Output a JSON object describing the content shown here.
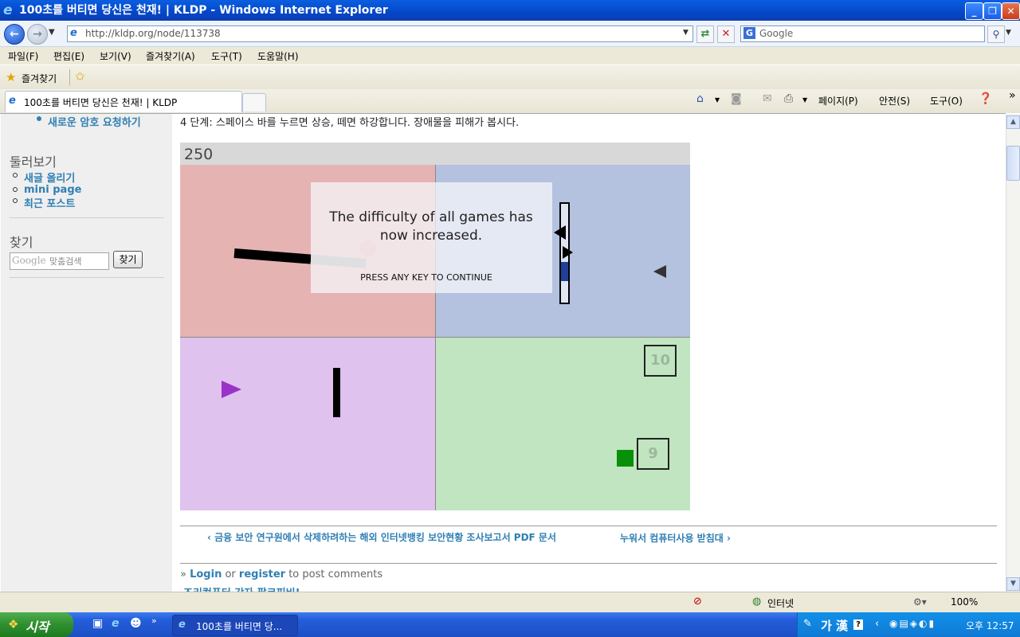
{
  "window": {
    "title": "100초를 버티면 당신은 천재! | KLDP - Windows Internet Explorer",
    "minimize": "_",
    "restore": "❐",
    "close": "✕"
  },
  "address_bar": {
    "url": "http://kldp.org/node/113738",
    "search_placeholder": "Google",
    "search_logo": "G"
  },
  "menu": [
    "파일(F)",
    "편집(E)",
    "보기(V)",
    "즐겨찾기(A)",
    "도구(T)",
    "도움말(H)"
  ],
  "favorites": {
    "label": "즐겨찾기"
  },
  "tab": {
    "title": "100초를 버티면 당신은 천재! | KLDP"
  },
  "command_bar": {
    "page": "페이지(P)",
    "safety": "안전(S)",
    "tools": "도구(O)"
  },
  "sidebar": {
    "top_link": "새로운 암호 요청하기",
    "browse_title": "둘러보기",
    "browse_links": [
      "새글 올리기",
      "mini page",
      "최근 포스트"
    ],
    "search_title": "찾기",
    "search_brand": "Google",
    "search_hint": "맞춤검색",
    "search_button": "찾기"
  },
  "article": {
    "top_text": "4 단계: 스페이스 바를 누르면 상승, 떼면 하강합니다. 장애물을 피해가 봅시다.",
    "prev_link": "‹ 금융 보안 연구원에서 삭제하려하는 해외 인터넷뱅킹 보안현황 조사보고서 PDF 문서",
    "next_link": "누워서 컴퓨터사용 받침대 ›",
    "login_prefix": "» ",
    "login": "Login",
    "or": " or ",
    "register": "register",
    "login_suffix": " to post comments",
    "bottom_cut": "조리컴퓨터 강자 팔코피비!"
  },
  "game": {
    "score": "250",
    "overlay_message": "The difficulty of all games has now increased.",
    "overlay_continue": "PRESS ANY KEY TO CONTINUE",
    "box_top": "10",
    "box_bottom": "9",
    "colors": {
      "red_quadrant": "#e6b3b3",
      "blue_quadrant": "#b4c2e0",
      "purple_quadrant": "#e0c2ee",
      "green_quadrant": "#c1e5c1"
    }
  },
  "status_bar": {
    "zone": "인터넷",
    "zoom": "100%"
  },
  "taskbar": {
    "start": "시작",
    "task": "100초를 버티면 당...",
    "ime": "가 漢",
    "help": "?",
    "time": "오후 12:57"
  }
}
